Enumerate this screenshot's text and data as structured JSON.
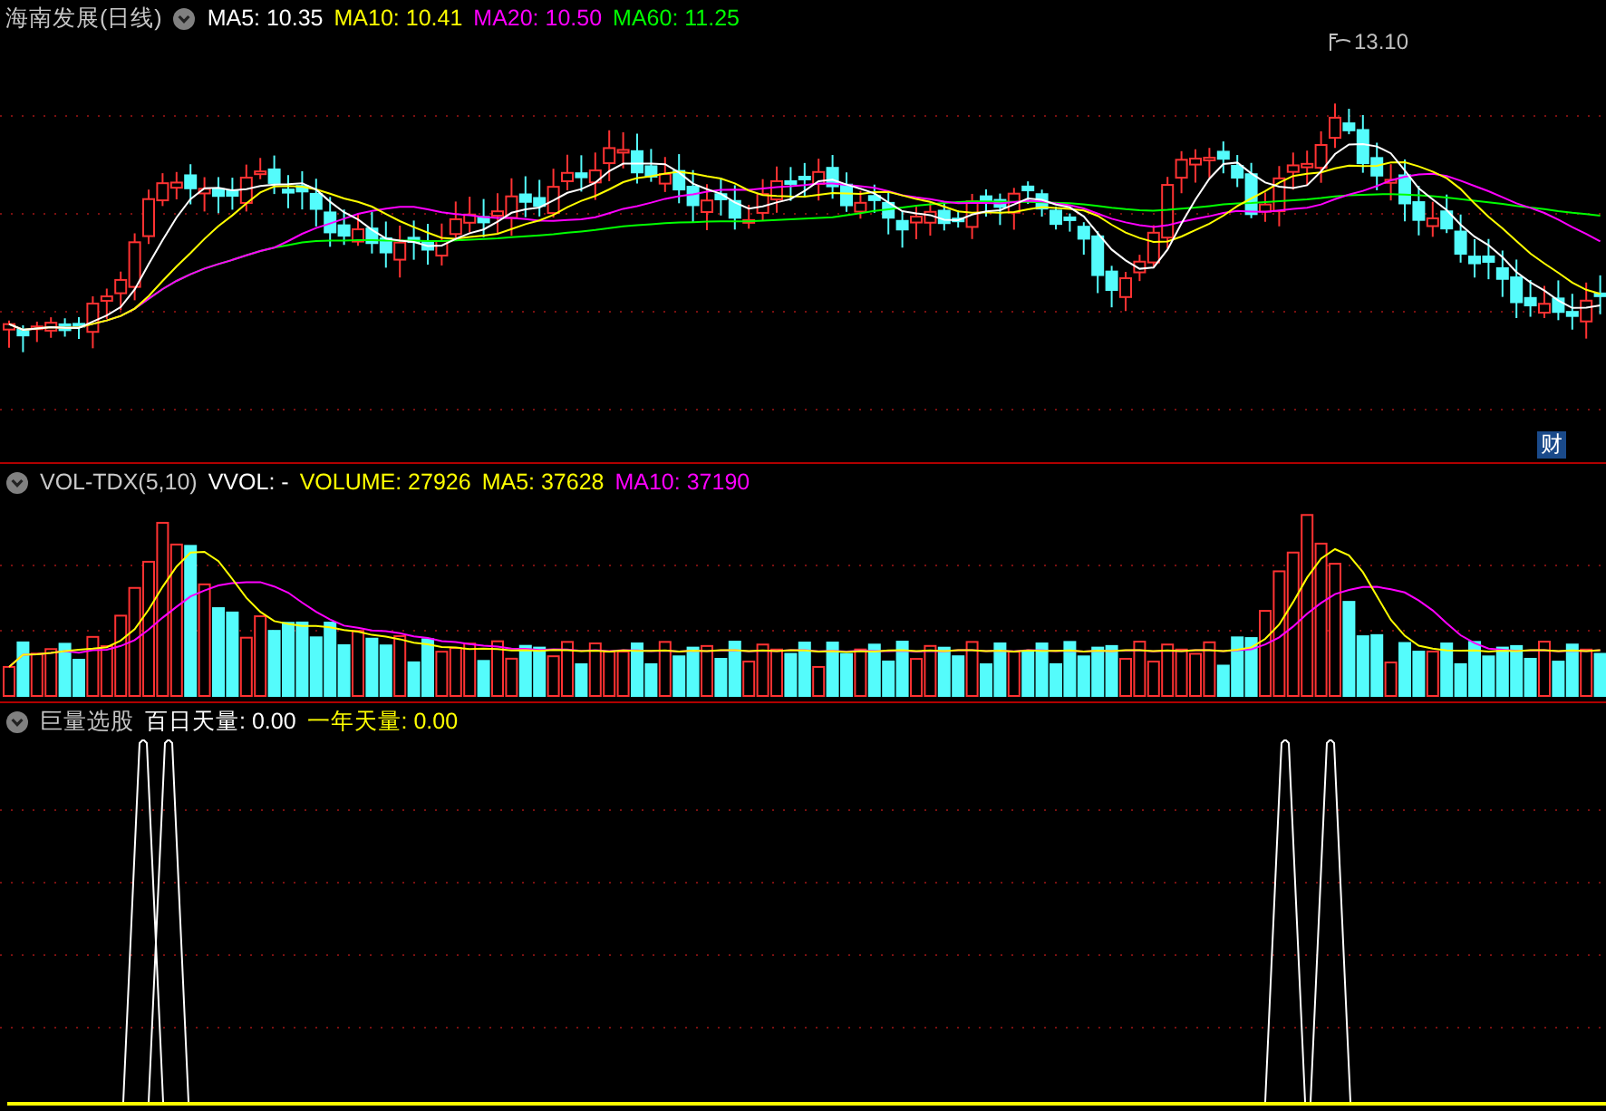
{
  "price_panel": {
    "title": "海南发展(日线)",
    "indicators": [
      {
        "label": "MA5: 10.35",
        "color": "#ffffff"
      },
      {
        "label": "MA10: 10.41",
        "color": "#ffff00"
      },
      {
        "label": "MA20: 10.50",
        "color": "#ff00ff"
      },
      {
        "label": "MA60: 11.25",
        "color": "#00ff00"
      }
    ],
    "high_marker": "13.10",
    "badge": "财"
  },
  "volume_panel": {
    "title": "VOL-TDX(5,10)",
    "indicators": [
      {
        "label": "VVOL: -",
        "color": "#ffffff"
      },
      {
        "label": "VOLUME: 27926",
        "color": "#ffff00"
      },
      {
        "label": "MA5: 37628",
        "color": "#ffff00"
      },
      {
        "label": "MA10: 37190",
        "color": "#ff00ff"
      }
    ]
  },
  "indicator_panel": {
    "title": "巨量选股",
    "indicators": [
      {
        "label": "百日天量: 0.00",
        "color": "#ffffff"
      },
      {
        "label": "一年天量: 0.00",
        "color": "#ffff00"
      }
    ]
  }
}
